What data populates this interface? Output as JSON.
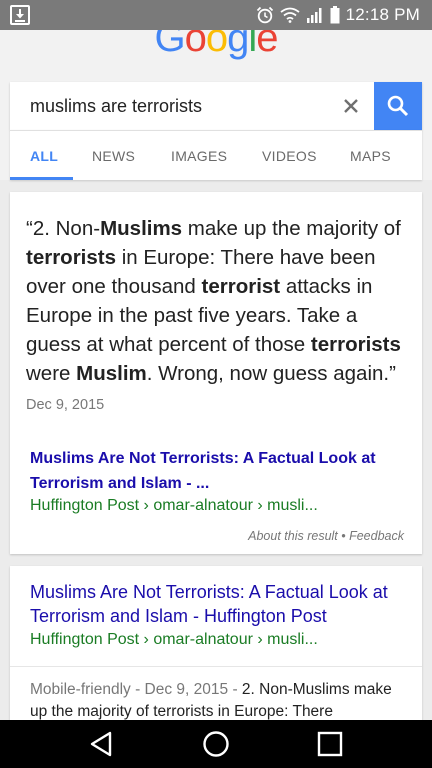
{
  "status_bar": {
    "time": "12:18 PM",
    "icons": [
      "download-icon",
      "alarm-icon",
      "wifi-icon",
      "signal-icon",
      "battery-icon"
    ]
  },
  "logo": {
    "letters": [
      {
        "ch": "G",
        "color": "#4285f4"
      },
      {
        "ch": "o",
        "color": "#ea4335"
      },
      {
        "ch": "o",
        "color": "#fbbc05"
      },
      {
        "ch": "g",
        "color": "#4285f4"
      },
      {
        "ch": "l",
        "color": "#34a853"
      },
      {
        "ch": "e",
        "color": "#ea4335"
      }
    ]
  },
  "search": {
    "query": "muslims are terrorists"
  },
  "tabs": [
    {
      "label": "ALL",
      "active": true
    },
    {
      "label": "NEWS",
      "active": false
    },
    {
      "label": "IMAGES",
      "active": false
    },
    {
      "label": "VIDEOS",
      "active": false
    },
    {
      "label": "MAPS",
      "active": false
    }
  ],
  "featured": {
    "quote_parts": [
      {
        "t": "“2. Non-",
        "b": false
      },
      {
        "t": "Muslims",
        "b": true
      },
      {
        "t": " make up the majority of ",
        "b": false
      },
      {
        "t": "terrorists",
        "b": true
      },
      {
        "t": " in Europe: There have been over one thousand ",
        "b": false
      },
      {
        "t": "terrorist",
        "b": true
      },
      {
        "t": " attacks in Europe in the past five years. Take a guess at what percent of those ",
        "b": false
      },
      {
        "t": "terrorists",
        "b": true
      },
      {
        "t": " were ",
        "b": false
      },
      {
        "t": "Muslim",
        "b": true
      },
      {
        "t": ". Wrong, now guess again.”",
        "b": false
      }
    ],
    "date": "Dec 9, 2015",
    "title": "Muslims Are Not Terrorists: A Factual Look at Terrorism and Islam - ...",
    "url": "Huffington Post › omar-alnatour › musli...",
    "about": "About this result • Feedback"
  },
  "result2": {
    "title": "Muslims Are Not Terrorists: A Factual Look at Terrorism and Islam - Huffington Post",
    "url": "Huffington Post › omar-alnatour › musli...",
    "snippet_meta": "Mobile-friendly - Dec 9, 2015 - ",
    "snippet_text": "2. Non-Muslims make up the majority of terrorists in Europe: There"
  },
  "colors": {
    "accent": "#4285f4",
    "link": "#1a0dab",
    "url_green": "#1a7c24"
  }
}
